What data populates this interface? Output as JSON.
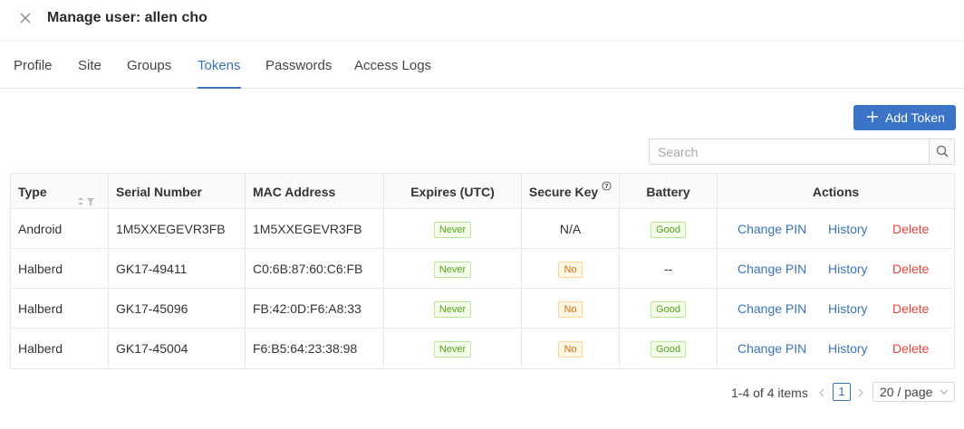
{
  "header": {
    "title": "Manage user: allen cho"
  },
  "tabs": [
    {
      "label": "Profile"
    },
    {
      "label": "Site"
    },
    {
      "label": "Groups"
    },
    {
      "label": "Tokens"
    },
    {
      "label": "Passwords"
    },
    {
      "label": "Access Logs"
    }
  ],
  "active_tab": "Tokens",
  "toolbar": {
    "add_label": "Add Token"
  },
  "search": {
    "placeholder": "Search",
    "value": ""
  },
  "table": {
    "columns": [
      "Type",
      "Serial Number",
      "MAC Address",
      "Expires (UTC)",
      "Secure Key",
      "Battery",
      "Actions"
    ],
    "rows": [
      {
        "type": "Android",
        "serial": "1M5XXEGEVR3FB",
        "mac": "1M5XXEGEVR3FB",
        "expires": "Never",
        "secure_key": "N/A",
        "battery": "Good"
      },
      {
        "type": "Halberd",
        "serial": "GK17-49411",
        "mac": "C0:6B:87:60:C6:FB",
        "expires": "Never",
        "secure_key": "No",
        "battery": "--"
      },
      {
        "type": "Halberd",
        "serial": "GK17-45096",
        "mac": "FB:42:0D:F6:A8:33",
        "expires": "Never",
        "secure_key": "No",
        "battery": "Good"
      },
      {
        "type": "Halberd",
        "serial": "GK17-45004",
        "mac": "F6:B5:64:23:38:98",
        "expires": "Never",
        "secure_key": "No",
        "battery": "Good"
      }
    ],
    "actions": {
      "change_pin": "Change PIN",
      "history": "History",
      "delete": "Delete"
    }
  },
  "pagination": {
    "summary": "1-4 of 4 items",
    "current_page": "1",
    "page_size": "20 / page"
  },
  "colors": {
    "accent": "#3b73b9",
    "danger": "#e8453c",
    "tag_green": "#52a31a",
    "tag_orange": "#d46b08"
  }
}
